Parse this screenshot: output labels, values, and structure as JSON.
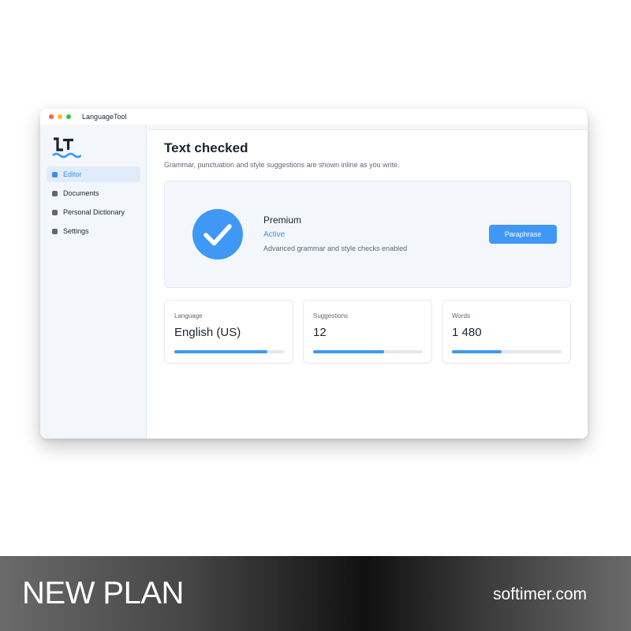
{
  "window": {
    "title": "LanguageTool",
    "controls": [
      "close-icon",
      "minimize-icon",
      "zoom-icon"
    ]
  },
  "sidebar": {
    "logo": "languagetool-logo-icon",
    "items": [
      {
        "label": "Editor",
        "active": true
      },
      {
        "label": "Documents",
        "active": false
      },
      {
        "label": "Personal Dictionary",
        "active": false
      },
      {
        "label": "Settings",
        "active": false
      }
    ]
  },
  "main": {
    "title": "Text checked",
    "subtitle": "Grammar, punctuation and style suggestions are shown inline as you write.",
    "status_card": {
      "icon": "checkmark-circle-icon",
      "plan": "Premium",
      "status": "Active",
      "description": "Advanced grammar and style checks enabled",
      "button_label": "Paraphrase"
    },
    "stats": [
      {
        "label": "Language",
        "value": "English (US)",
        "progress": 0.85
      },
      {
        "label": "Suggestions",
        "value": "12",
        "progress": 0.65
      },
      {
        "label": "Words",
        "value": "1 480",
        "progress": 0.45
      }
    ]
  },
  "banner": {
    "left_text": "NEW PLAN",
    "right_text": "softimer.com"
  },
  "colors": {
    "accent": "#3f98f5",
    "sidebar_bg": "#f3f7fc",
    "text": "#1c2330",
    "muted": "#5f6675"
  }
}
